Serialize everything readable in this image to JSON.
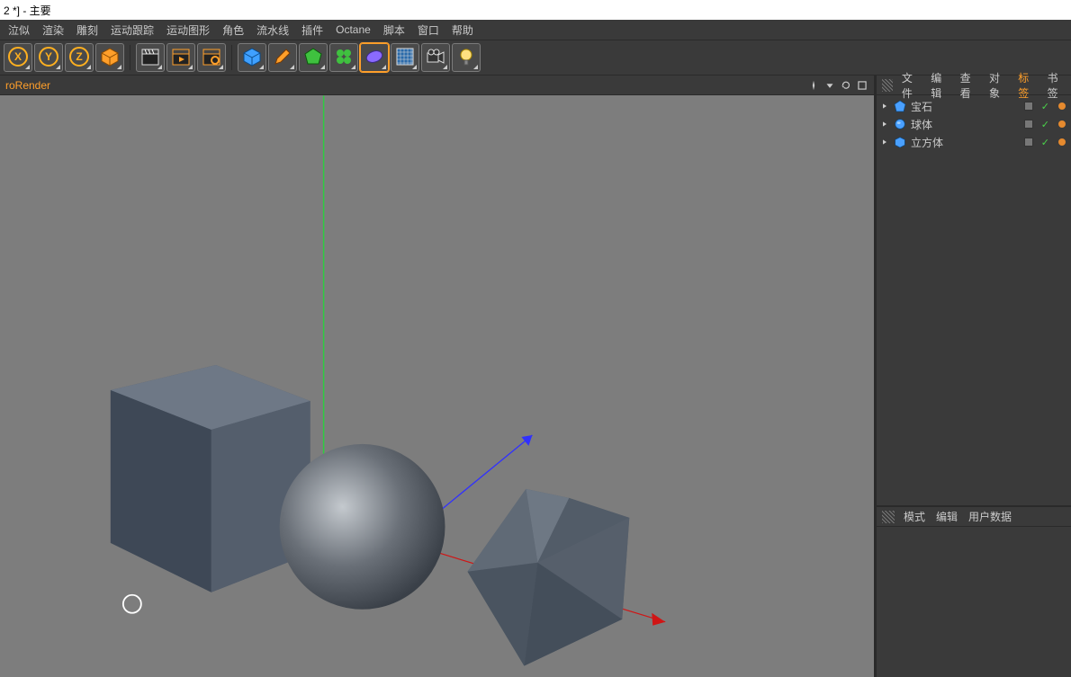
{
  "window_title": "2 *] - 主要",
  "menu": {
    "items": [
      "泣似",
      "渲染",
      "雕刻",
      "运动跟踪",
      "运动图形",
      "角色",
      "流水线",
      "插件",
      "Octane",
      "脚本",
      "窗口",
      "帮助"
    ]
  },
  "toolbar": {
    "groups": [
      [
        "axis-x",
        "axis-y",
        "axis-z",
        "cube-orange"
      ],
      [
        "clapper-basic",
        "clapper-play",
        "clapper-gear"
      ],
      [
        "cube-blue",
        "pen",
        "polygon-green",
        "clover",
        "bean-purple",
        "grid",
        "video-camera",
        "lightbulb"
      ]
    ],
    "selected": "bean-purple"
  },
  "viewport": {
    "title_left": "roRender",
    "icons": [
      "compass-icon",
      "down-icon",
      "refresh-icon",
      "maximize-icon"
    ]
  },
  "objects_panel": {
    "menu": [
      "文件",
      "编辑",
      "查看",
      "对象",
      "标签",
      "书签"
    ],
    "active": "标签",
    "rows": [
      {
        "kind": "gem",
        "label": "宝石"
      },
      {
        "kind": "sphere",
        "label": "球体"
      },
      {
        "kind": "cube",
        "label": "立方体"
      }
    ]
  },
  "attr_panel": {
    "menu": [
      "模式",
      "编辑",
      "用户数据"
    ]
  }
}
